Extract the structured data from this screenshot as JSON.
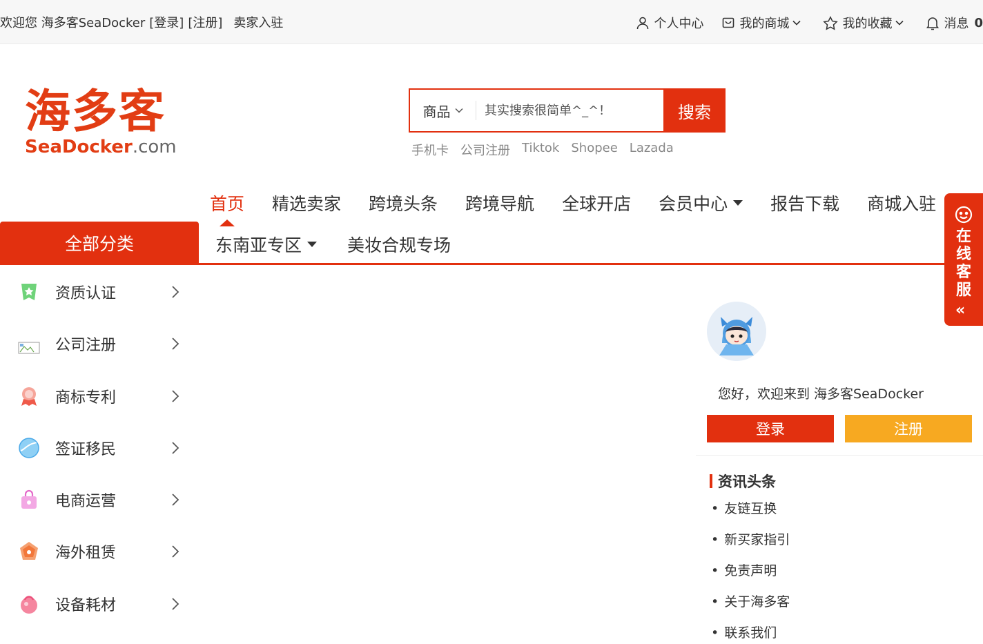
{
  "topbar": {
    "welcome": "欢迎您 海多客SeaDocker",
    "login_link": "[登录]",
    "register_link": "[注册]",
    "seller_join": "卖家入驻",
    "personal_center": "个人中心",
    "my_mall": "我的商城",
    "my_favorites": "我的收藏",
    "messages": "消息",
    "message_count": "0"
  },
  "logo": {
    "cn": "海多客",
    "en_main": "SeaDocker",
    "en_suffix": ".com"
  },
  "search": {
    "type_label": "商品",
    "placeholder": "其实搜索很简单^_^！",
    "button_label": "搜索",
    "hot_words": [
      "手机卡",
      "公司注册",
      "Tiktok",
      "Shopee",
      "Lazada"
    ]
  },
  "nav": {
    "primary": [
      {
        "label": "首页",
        "active": true,
        "dropdown": false
      },
      {
        "label": "精选卖家",
        "active": false,
        "dropdown": false
      },
      {
        "label": "跨境头条",
        "active": false,
        "dropdown": false
      },
      {
        "label": "跨境导航",
        "active": false,
        "dropdown": false
      },
      {
        "label": "全球开店",
        "active": false,
        "dropdown": false
      },
      {
        "label": "会员中心",
        "active": false,
        "dropdown": true
      },
      {
        "label": "报告下载",
        "active": false,
        "dropdown": false
      },
      {
        "label": "商城入驻",
        "active": false,
        "dropdown": false
      }
    ],
    "secondary": [
      {
        "label": "东南亚专区",
        "dropdown": true
      },
      {
        "label": "美妆合规专场",
        "dropdown": false
      }
    ]
  },
  "categories": {
    "title": "全部分类",
    "items": [
      {
        "label": "资质认证",
        "icon": "certificate-icon",
        "color": "#5ac46a"
      },
      {
        "label": "公司注册",
        "icon": "broken-image-icon",
        "color": "#999999"
      },
      {
        "label": "商标专利",
        "icon": "trademark-icon",
        "color": "#f06a5a"
      },
      {
        "label": "签证移民",
        "icon": "visa-icon",
        "color": "#4aa9e8"
      },
      {
        "label": "电商运营",
        "icon": "ecommerce-bag-icon",
        "color": "#e46ac9"
      },
      {
        "label": "海外租赁",
        "icon": "lease-icon",
        "color": "#f2773a"
      },
      {
        "label": "设备耗材",
        "icon": "equipment-icon",
        "color": "#ec4f7a"
      }
    ]
  },
  "user_panel": {
    "greeting": "您好，欢迎来到 海多客SeaDocker",
    "login_button": "登录",
    "register_button": "注册"
  },
  "news": {
    "title": "资讯头条",
    "items": [
      "友链互换",
      "新买家指引",
      "免责声明",
      "关于海多客",
      "联系我们"
    ]
  },
  "service_float": {
    "label": "在线客服",
    "collapse_glyph": "«"
  },
  "colors": {
    "brand_red": "#e2300f",
    "register_orange": "#f7a921"
  }
}
